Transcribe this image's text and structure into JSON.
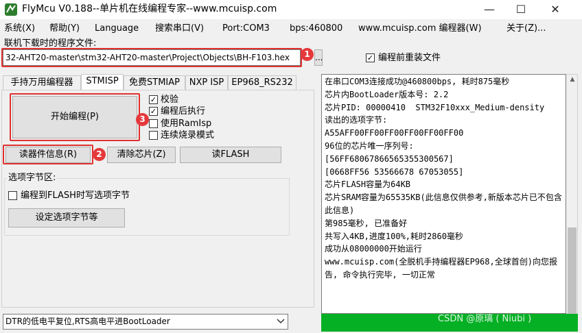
{
  "window": {
    "title": "FlyMcu V0.188--单片机在线编程专家--www.mcuisp.com",
    "minimize": "—",
    "maximize": "☐",
    "close": "✕"
  },
  "menu": [
    "系统(X)",
    "帮助(Y)",
    "Language",
    "搜索串口(V)",
    "Port:COM3",
    "bps:460800",
    "www.mcuisp.com 编程器(W)",
    "关于(Z)..."
  ],
  "file": {
    "label": "联机下载时的程序文件:",
    "path": "32-AHT20-master\\stm32-AHT20-master\\Project\\Objects\\BH-F103.hex",
    "browse": "...",
    "reload_checked": "✓",
    "reload_label": "编程前重装文件"
  },
  "badges": {
    "b1": "1",
    "b2": "2",
    "b3": "3"
  },
  "tabs": [
    "手持万用编程器",
    "STMISP",
    "免费STMIAP",
    "NXP ISP",
    "EP968_RS232"
  ],
  "stmisp": {
    "start_button": "开始编程(P)",
    "options": [
      {
        "label": "校验",
        "checked": "✓"
      },
      {
        "label": "编程后执行",
        "checked": "✓"
      },
      {
        "label": "使用RamIsp",
        "checked": ""
      },
      {
        "label": "连续烧录模式",
        "checked": ""
      }
    ],
    "read_info": "读器件信息(R)",
    "erase_chip": "清除芯片(Z)",
    "read_flash": "读FLASH",
    "option_section": "选项字节区:",
    "write_option_label": "编程到FLASH时写选项字节",
    "write_option_checked": "",
    "set_option_button": "设定选项字节等"
  },
  "log": "在串口COM3连接成功@460800bps, 耗时875毫秒\n芯片内BootLoader版本号: 2.2\n芯片PID: 00000410  STM32F10xxx_Medium-density\n读出的选项字节:\nA55AFF00FF00FF00FF00FF00FF00\n96位的芯片唯一序列号:\n[56FF68067866565355300567]\n[0668FF56 53566678 67053055]\n芯片FLASH容量为64KB\n芯片SRAM容量为65535KB(此信息仅供参考,新版本芯片已不包含此信息)\n第985毫秒, 已准备好\n共写入4KB,进度100%,耗时2860毫秒\n成功从08000000开始运行\nwww.mcuisp.com(全脱机手持编程器EP968,全球首创)向您报告, 命令执行完毕, 一切正常",
  "reset_mode": "DTR的低电平复位,RTS高电平进BootLoader",
  "dropdown_icon": "chevron-down-icon",
  "watermark": "CSDN @原璃 ( Niubi )",
  "colors": {
    "highlight": "#e03030",
    "progress": "#06b025"
  }
}
